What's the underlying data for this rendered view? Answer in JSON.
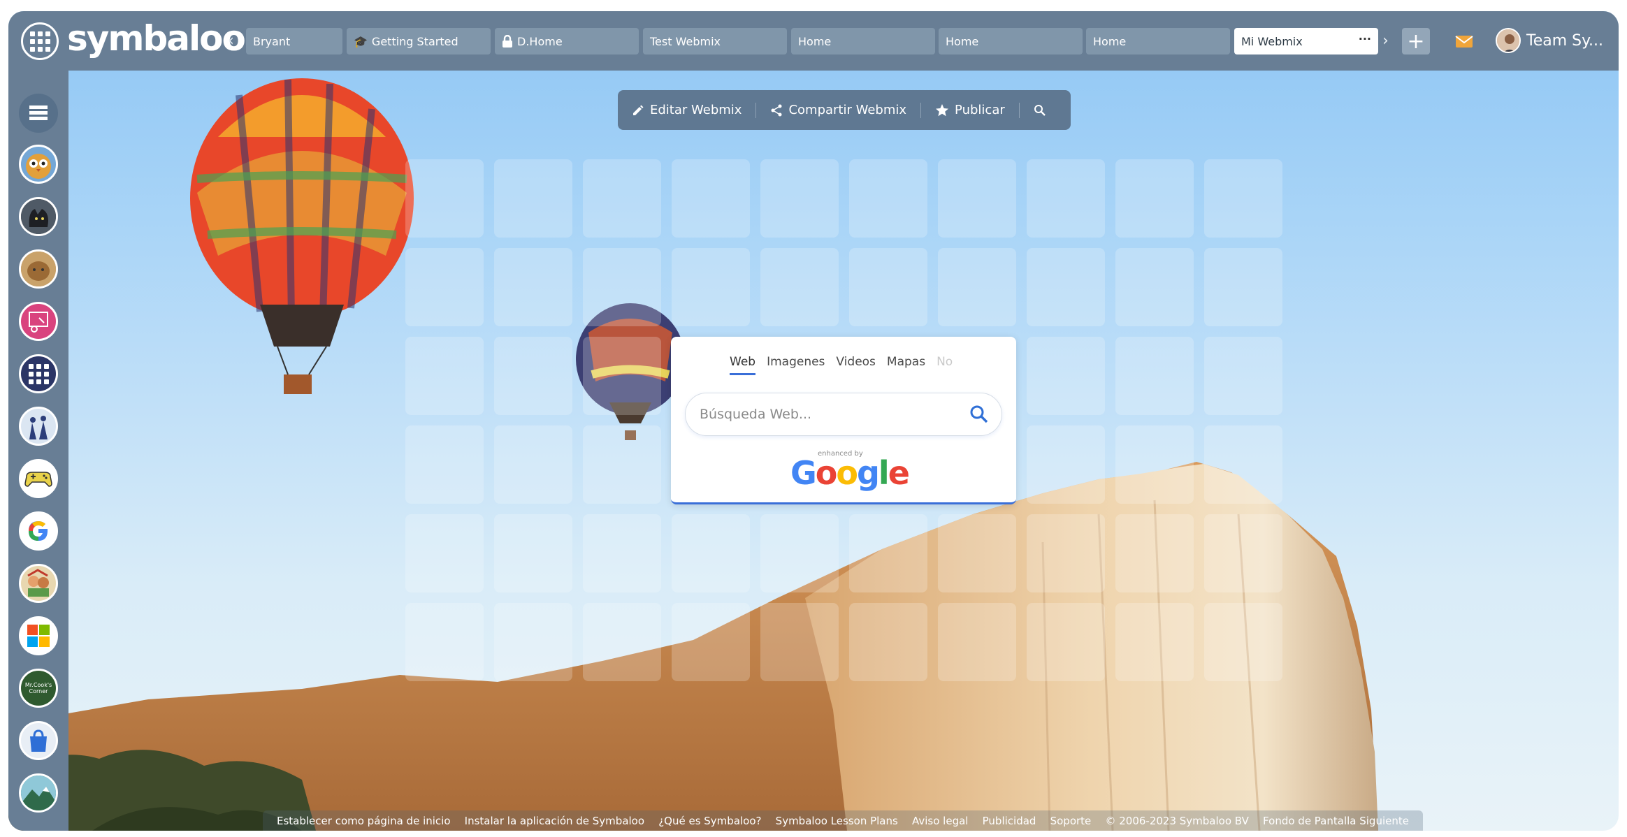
{
  "brand": {
    "logo_text": "symbaloo"
  },
  "tabs": [
    {
      "label": "Bryant",
      "icon": "none"
    },
    {
      "label": "Getting Started",
      "icon": "graduation-cap-icon"
    },
    {
      "label": "D.Home",
      "icon": "lock-icon"
    },
    {
      "label": "Test Webmix",
      "icon": "none"
    },
    {
      "label": "Home",
      "icon": "none"
    },
    {
      "label": "Home",
      "icon": "none"
    },
    {
      "label": "Home",
      "icon": "none"
    },
    {
      "label": "Mi Webmix",
      "icon": "none",
      "active": true,
      "menu": "···"
    }
  ],
  "user": {
    "name": "Team Sy..."
  },
  "toolbar": {
    "edit_label": "Editar Webmix",
    "share_label": "Compartir Webmix",
    "publish_label": "Publicar"
  },
  "search": {
    "tabs": [
      "Web",
      "Imagenes",
      "Videos",
      "Mapas",
      "No"
    ],
    "active_tab": "Web",
    "placeholder": "Búsqueda Web...",
    "enhanced_text": "enhanced by",
    "google_text": "Google"
  },
  "sidebar": {
    "items": [
      "owl-cartoon-icon",
      "black-cat-icon",
      "tabby-cat-icon",
      "classroom-presentation-icon",
      "apps-grid-icon",
      "graduation-students-icon",
      "game-controller-icon",
      "google-g-icon",
      "kids-cartoon-icon",
      "microsoft-logo-icon",
      "mr-cooks-corner-icon",
      "shopping-bag-icon",
      "mountain-landscape-icon"
    ],
    "mr_cooks_label": "Mr.Cook's Corner"
  },
  "footer": {
    "links": [
      "Establecer como página de inicio",
      "Instalar la aplicación de Symbaloo",
      "¿Qué es Symbaloo?",
      "Symbaloo Lesson Plans",
      "Aviso legal",
      "Publicidad",
      "Soporte",
      "© 2006-2023 Symbaloo BV",
      "Fondo de Pantalla Siguiente"
    ]
  },
  "colors": {
    "bar": "#687e95",
    "toolbar": "#5f7892",
    "accent_blue": "#3a6fd8",
    "mail_orange": "#f0a53a"
  }
}
